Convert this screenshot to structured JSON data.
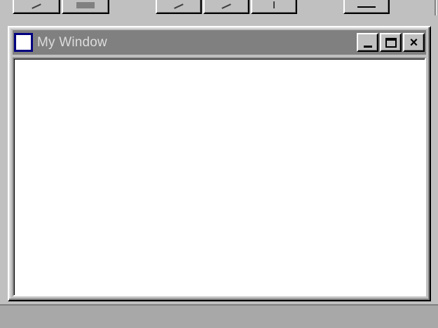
{
  "window": {
    "title": "My Window",
    "controls": {
      "minimize_icon": "minimize-icon",
      "maximize_icon": "maximize-icon",
      "close_glyph": "×"
    }
  },
  "colors": {
    "desktop": "#c0c0c0",
    "titlebar_inactive": "#808080",
    "title_text": "#dcdcdc",
    "icon_border": "#000080",
    "client": "#ffffff"
  },
  "toolbar": {
    "buttons": [
      {
        "icon": "arrow-icon"
      },
      {
        "icon": "block-icon"
      },
      {
        "icon": "arrow-icon"
      },
      {
        "icon": "arrow-icon"
      },
      {
        "icon": "line-icon"
      },
      {
        "icon": "dash-icon"
      }
    ]
  }
}
